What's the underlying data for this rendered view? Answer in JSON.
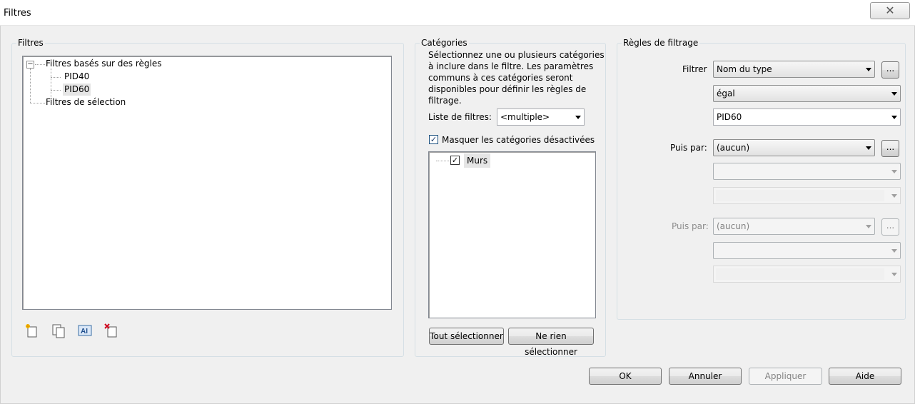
{
  "window": {
    "title": "Filtres",
    "close_glyph": "✕"
  },
  "filters_panel": {
    "label": "Filtres",
    "tree": {
      "root_label": "Filtres basés sur des règles",
      "root_expander": "−",
      "children": [
        "PID40",
        "PID60"
      ],
      "selection_label": "Filtres de sélection"
    },
    "toolbar_icons": [
      "new-filter-icon",
      "duplicate-filter-icon",
      "rename-filter-icon",
      "delete-filter-icon"
    ]
  },
  "categories_panel": {
    "label": "Catégories",
    "description_lines": [
      "Sélectionnez une ou plusieurs catégories",
      "à inclure dans le filtre. Les paramètres",
      "communs à ces catégories seront",
      "disponibles pour définir les règles de",
      "filtrage."
    ],
    "filter_list_label": "Liste de filtres:",
    "filter_list_value": "<multiple>",
    "hide_disabled_label": "Masquer les catégories désactivées",
    "hide_disabled_checked": "✓",
    "category_items": [
      {
        "label": "Murs",
        "checked": "✓"
      }
    ],
    "select_all_label": "Tout sélectionner",
    "select_none_label": "Ne rien sélectionner"
  },
  "rules_panel": {
    "label": "Règles de filtrage",
    "filter_label": "Filtrer",
    "parameter_value": "Nom du type",
    "operator_value": "égal",
    "value_value": "PID60",
    "then_by_label_1": "Puis par:",
    "then_by_value_1": "(aucun)",
    "then_by_label_2": "Puis par:",
    "then_by_value_2": "(aucun)",
    "ellipsis": "..."
  },
  "buttons": {
    "ok": "OK",
    "cancel": "Annuler",
    "apply": "Appliquer",
    "help": "Aide"
  }
}
